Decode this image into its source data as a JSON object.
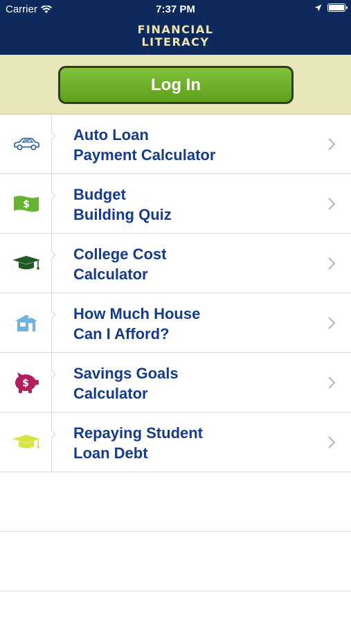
{
  "status": {
    "carrier": "Carrier",
    "time": "7:37 PM"
  },
  "header": {
    "title_line1": "FINANCIAL",
    "title_line2": "LITERACY"
  },
  "login": {
    "label": "Log In"
  },
  "items": [
    {
      "line1": "Auto Loan",
      "line2": "Payment Calculator",
      "icon": "car-icon"
    },
    {
      "line1": "Budget",
      "line2": "Building Quiz",
      "icon": "dollar-bill-icon"
    },
    {
      "line1": "College Cost",
      "line2": "Calculator",
      "icon": "graduation-cap-icon"
    },
    {
      "line1": "How Much House",
      "line2": "Can I Afford?",
      "icon": "house-icon"
    },
    {
      "line1": "Savings Goals",
      "line2": "Calculator",
      "icon": "piggy-bank-icon"
    },
    {
      "line1": "Repaying Student",
      "line2": "Loan Debt",
      "icon": "graduation-cap-icon"
    }
  ],
  "colors": {
    "header_bg": "#0e2a5c",
    "title": "#f1e6ad",
    "band": "#e9e6b9",
    "button_green": "#6cae29",
    "label_blue": "#153b8c"
  }
}
